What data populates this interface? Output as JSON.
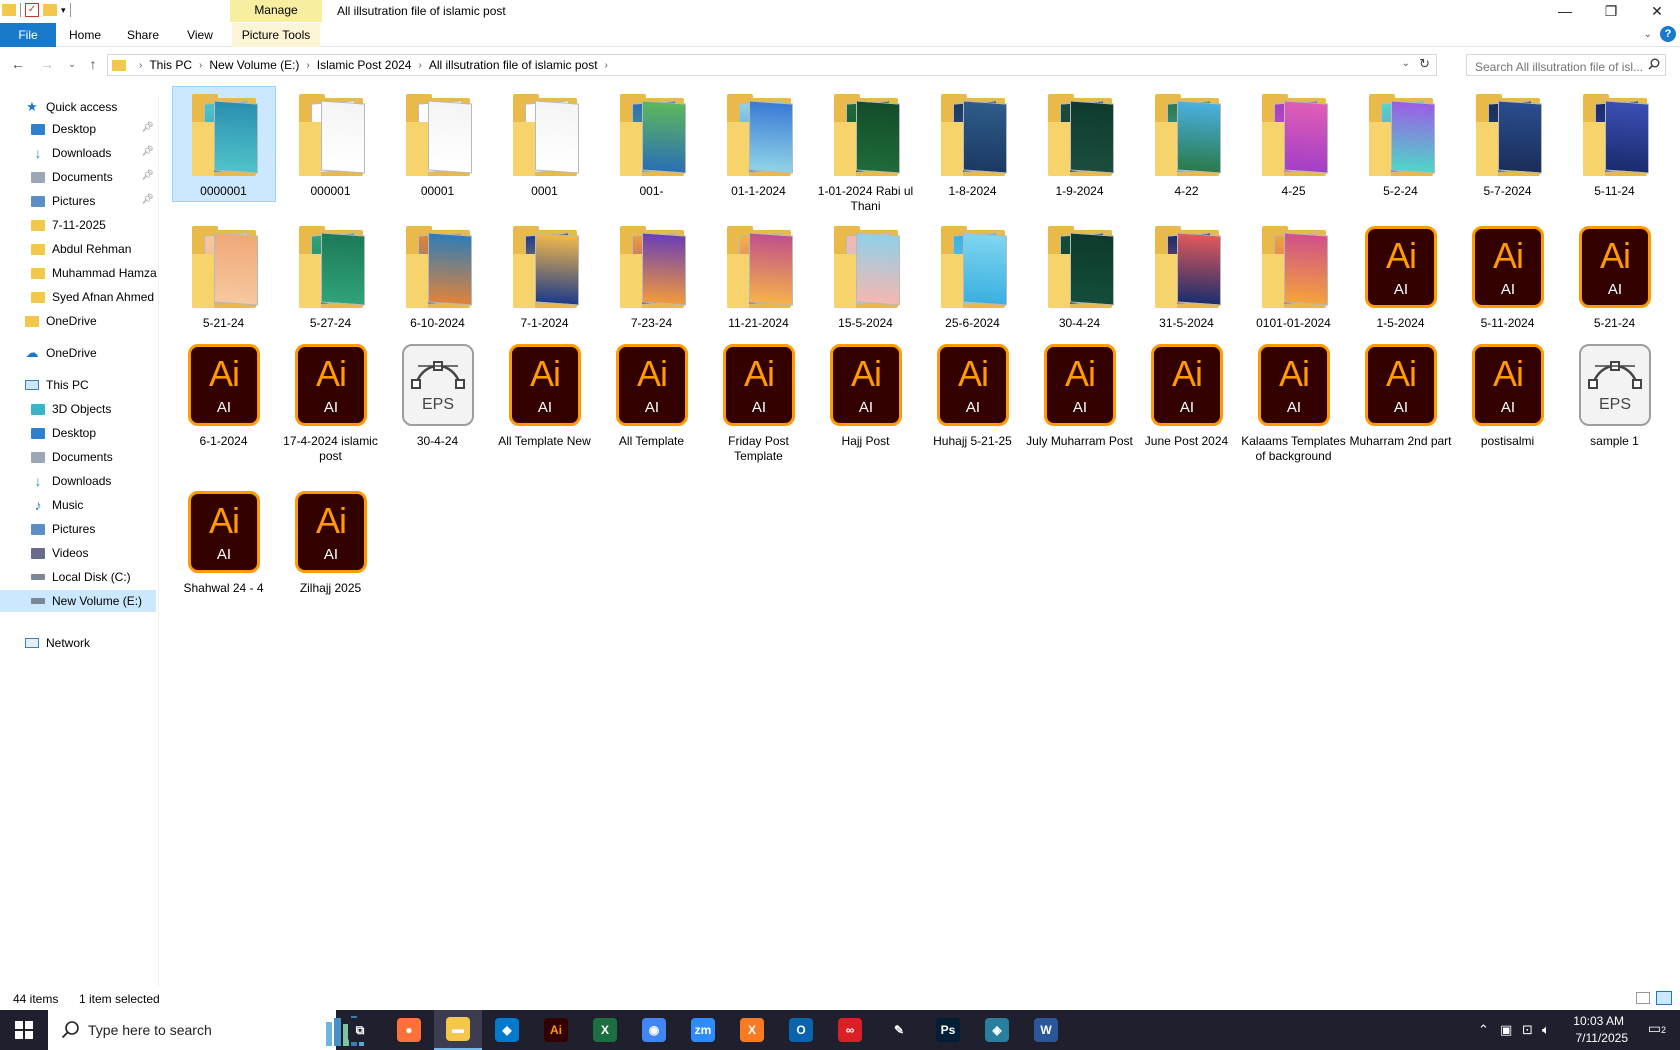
{
  "window": {
    "title": "All illsutration file of islamic post",
    "manage_label": "Manage",
    "minimize": "—",
    "restore": "❐",
    "close": "✕"
  },
  "ribbon": {
    "tabs": [
      "File",
      "Home",
      "Share",
      "View",
      "Picture Tools"
    ],
    "help": "?"
  },
  "address": {
    "crumbs": [
      "This PC",
      "New Volume (E:)",
      "Islamic Post 2024",
      "All illsutration file of islamic post"
    ],
    "search_placeholder": "Search All illsutration file of isl..."
  },
  "nav": {
    "quick_access": "Quick access",
    "items": [
      {
        "label": "Desktop",
        "icon": "desktop-icon",
        "pinned": true
      },
      {
        "label": "Downloads",
        "icon": "downloads-icon",
        "pinned": true
      },
      {
        "label": "Documents",
        "icon": "documents-icon",
        "pinned": true
      },
      {
        "label": "Pictures",
        "icon": "pictures-icon",
        "pinned": true
      },
      {
        "label": "7-11-2025",
        "icon": "folder-icon",
        "pinned": false
      },
      {
        "label": "Abdul Rehman",
        "icon": "folder-icon",
        "pinned": false
      },
      {
        "label": "Muhammad Hamza",
        "icon": "folder-icon",
        "pinned": false
      },
      {
        "label": "Syed Afnan Ahmed",
        "icon": "folder-icon",
        "pinned": false
      }
    ],
    "onedrive_1": "OneDrive",
    "onedrive_2": "OneDrive",
    "this_pc": "This PC",
    "pc_items": [
      {
        "label": "3D Objects",
        "icon": "3d-objects-icon"
      },
      {
        "label": "Desktop",
        "icon": "desktop-icon"
      },
      {
        "label": "Documents",
        "icon": "documents-icon"
      },
      {
        "label": "Downloads",
        "icon": "downloads-icon"
      },
      {
        "label": "Music",
        "icon": "music-icon"
      },
      {
        "label": "Pictures",
        "icon": "pictures-icon"
      },
      {
        "label": "Videos",
        "icon": "videos-icon"
      },
      {
        "label": "Local Disk (C:)",
        "icon": "local-disk-icon"
      },
      {
        "label": "New Volume (E:)",
        "icon": "drive-icon"
      }
    ],
    "network": "Network"
  },
  "files": [
    {
      "name": "0000001",
      "type": "folder",
      "thumb": [
        "#4fc3c9",
        "#2a8fb0"
      ],
      "selected": true
    },
    {
      "name": "000001",
      "type": "folder",
      "thumb": [
        "#ffffff",
        "#f4f4f4"
      ]
    },
    {
      "name": "00001",
      "type": "folder",
      "thumb": [
        "#ffffff",
        "#f4f4f4"
      ]
    },
    {
      "name": "0001",
      "type": "folder",
      "thumb": [
        "#ffffff",
        "#f4f4f4"
      ]
    },
    {
      "name": "001-",
      "type": "folder",
      "thumb": [
        "#2b6fb5",
        "#5cb85c"
      ]
    },
    {
      "name": "01-1-2024",
      "type": "folder",
      "thumb": [
        "#8fd3e8",
        "#3a7bd5"
      ]
    },
    {
      "name": "1-01-2024 Rabi ul Thani",
      "type": "folder",
      "thumb": [
        "#1f6b3a",
        "#134d2a"
      ]
    },
    {
      "name": "1-8-2024",
      "type": "folder",
      "thumb": [
        "#1b3a63",
        "#2e5c8a"
      ]
    },
    {
      "name": "1-9-2024",
      "type": "folder",
      "thumb": [
        "#1b4d3e",
        "#0f3b2f"
      ]
    },
    {
      "name": "4-22",
      "type": "folder",
      "thumb": [
        "#2a7a4b",
        "#4ab0e0"
      ]
    },
    {
      "name": "4-25",
      "type": "folder",
      "thumb": [
        "#a43fc8",
        "#e05db5"
      ]
    },
    {
      "name": "5-2-24",
      "type": "folder",
      "thumb": [
        "#4fd6c8",
        "#9b5de5"
      ]
    },
    {
      "name": "5-7-2024",
      "type": "folder",
      "thumb": [
        "#1b2e5a",
        "#2a4d8f"
      ]
    },
    {
      "name": "5-11-24",
      "type": "folder",
      "thumb": [
        "#1a2b6d",
        "#3b4fb5"
      ]
    },
    {
      "name": "5-21-24",
      "type": "folder",
      "thumb": [
        "#f6c89f",
        "#f0a878"
      ]
    },
    {
      "name": "5-27-24",
      "type": "folder",
      "thumb": [
        "#2fa37a",
        "#1d7a57"
      ]
    },
    {
      "name": "6-10-2024",
      "type": "folder",
      "thumb": [
        "#e0833a",
        "#2e7db8"
      ]
    },
    {
      "name": "7-1-2024",
      "type": "folder",
      "thumb": [
        "#1e3c8a",
        "#f2b84b"
      ]
    },
    {
      "name": "7-23-24",
      "type": "folder",
      "thumb": [
        "#f29a3a",
        "#6a3fb5"
      ]
    },
    {
      "name": "11-21-2024",
      "type": "folder",
      "thumb": [
        "#f6b24a",
        "#c0508a"
      ]
    },
    {
      "name": "15-5-2024",
      "type": "folder",
      "thumb": [
        "#f7b7b0",
        "#8fd0e8"
      ]
    },
    {
      "name": "25-6-2024",
      "type": "folder",
      "thumb": [
        "#3ab0e0",
        "#7fd5f0"
      ]
    },
    {
      "name": "30-4-24",
      "type": "folder",
      "thumb": [
        "#134d3a",
        "#0e3a2c"
      ]
    },
    {
      "name": "31-5-2024",
      "type": "folder",
      "thumb": [
        "#1b2e6d",
        "#e05a5a"
      ]
    },
    {
      "name": "0101-01-2024",
      "type": "folder",
      "thumb": [
        "#f4a33a",
        "#d0508a"
      ]
    },
    {
      "name": "1-5-2024",
      "type": "ai"
    },
    {
      "name": "5-11-2024",
      "type": "ai"
    },
    {
      "name": "5-21-24",
      "type": "ai"
    },
    {
      "name": "6-1-2024",
      "type": "ai"
    },
    {
      "name": "17-4-2024 islamic post",
      "type": "ai"
    },
    {
      "name": "30-4-24",
      "type": "eps"
    },
    {
      "name": "All Template New",
      "type": "ai"
    },
    {
      "name": "All Template",
      "type": "ai"
    },
    {
      "name": "Friday Post Template",
      "type": "ai"
    },
    {
      "name": "Hajj Post",
      "type": "ai"
    },
    {
      "name": "Huhajj 5-21-25",
      "type": "ai"
    },
    {
      "name": "July Muharram Post",
      "type": "ai"
    },
    {
      "name": "June Post 2024",
      "type": "ai"
    },
    {
      "name": "Kalaams Templates of background",
      "type": "ai"
    },
    {
      "name": "Muharram 2nd part",
      "type": "ai"
    },
    {
      "name": "postisalmi",
      "type": "ai"
    },
    {
      "name": "sample 1",
      "type": "eps"
    },
    {
      "name": "Shahwal 24 - 4",
      "type": "ai"
    },
    {
      "name": "Zilhajj 2025",
      "type": "ai"
    }
  ],
  "icon_text": {
    "ai_big": "Ai",
    "ai_small": "AI",
    "eps": "EPS"
  },
  "status": {
    "count": "44 items",
    "selected": "1 item selected"
  },
  "taskbar": {
    "search_placeholder": "Type here to search",
    "apps": [
      {
        "name": "task-view",
        "glyph": "⧉",
        "color": "#1f1f2e"
      },
      {
        "name": "firefox",
        "glyph": "●",
        "color": "#ff7139"
      },
      {
        "name": "file-explorer",
        "glyph": "▬",
        "color": "#f3c74b",
        "active": true
      },
      {
        "name": "vscode",
        "glyph": "◆",
        "color": "#007acc"
      },
      {
        "name": "illustrator",
        "glyph": "Ai",
        "color": "#330000"
      },
      {
        "name": "excel",
        "glyph": "X",
        "color": "#1d6f42"
      },
      {
        "name": "chrome",
        "glyph": "◉",
        "color": "#4285f4"
      },
      {
        "name": "zoom",
        "glyph": "zm",
        "color": "#2d8cff"
      },
      {
        "name": "xampp",
        "glyph": "X",
        "color": "#fb7a24"
      },
      {
        "name": "outlook",
        "glyph": "O",
        "color": "#0a64ad"
      },
      {
        "name": "creative-cloud",
        "glyph": "∞",
        "color": "#da1f26"
      },
      {
        "name": "pen-tool",
        "glyph": "✎",
        "color": "#1f1f2e"
      },
      {
        "name": "photoshop",
        "glyph": "Ps",
        "color": "#001e36"
      },
      {
        "name": "app-diamond",
        "glyph": "◈",
        "color": "#2a7f9e"
      },
      {
        "name": "word",
        "glyph": "W",
        "color": "#2b579a"
      }
    ],
    "time": "10:03 AM",
    "date": "7/11/2025",
    "notif_count": "2"
  }
}
